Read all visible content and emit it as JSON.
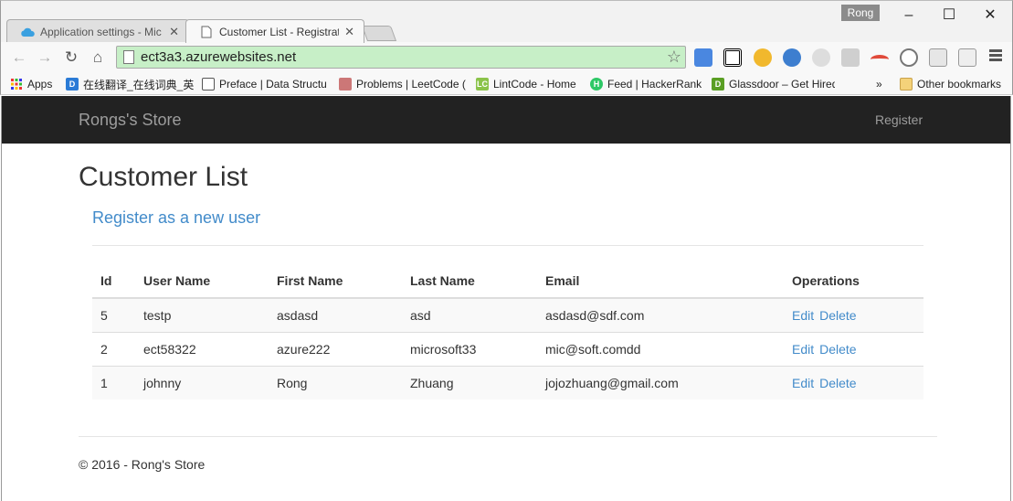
{
  "browser": {
    "profile_name": "Rong",
    "tabs": [
      {
        "title": "Application settings - Mic",
        "active": false
      },
      {
        "title": "Customer List - Registratio",
        "active": true
      }
    ],
    "url": "ect3a3.azurewebsites.net",
    "bookmarks": [
      {
        "label": "Apps",
        "icon": "apps-grid-icon"
      },
      {
        "label": "在线翻译_在线词典_英",
        "icon": "dict-icon"
      },
      {
        "label": "Preface | Data Structu",
        "icon": "book-icon"
      },
      {
        "label": "Problems | LeetCode (",
        "icon": "leetcode-icon"
      },
      {
        "label": "LintCode - Home",
        "icon": "lintcode-icon"
      },
      {
        "label": "Feed | HackerRank",
        "icon": "hackerrank-icon"
      },
      {
        "label": "Glassdoor – Get Hired",
        "icon": "glassdoor-icon"
      }
    ],
    "overflow": "»",
    "other_bookmarks": "Other bookmarks"
  },
  "site": {
    "brand": "Rongs's Store",
    "nav_register": "Register"
  },
  "main": {
    "title": "Customer List",
    "register_link": "Register as a new user",
    "table": {
      "headers": [
        "Id",
        "User Name",
        "First Name",
        "Last Name",
        "Email",
        "Operations"
      ],
      "rows": [
        {
          "id": "5",
          "username": "testp",
          "first": "asdasd",
          "last": "asd",
          "email": "asdasd@sdf.com",
          "edit": "Edit",
          "delete": "Delete"
        },
        {
          "id": "2",
          "username": "ect58322",
          "first": "azure222",
          "last": "microsoft33",
          "email": "mic@soft.comdd",
          "edit": "Edit",
          "delete": "Delete"
        },
        {
          "id": "1",
          "username": "johnny",
          "first": "Rong",
          "last": "Zhuang",
          "email": "jojozhuang@gmail.com",
          "edit": "Edit",
          "delete": "Delete"
        }
      ]
    }
  },
  "footer": {
    "text": "© 2016 - Rong's Store"
  },
  "colors": {
    "navbar": "#222222",
    "link": "#428bca",
    "omnibox_secure": "#c7efc7"
  }
}
